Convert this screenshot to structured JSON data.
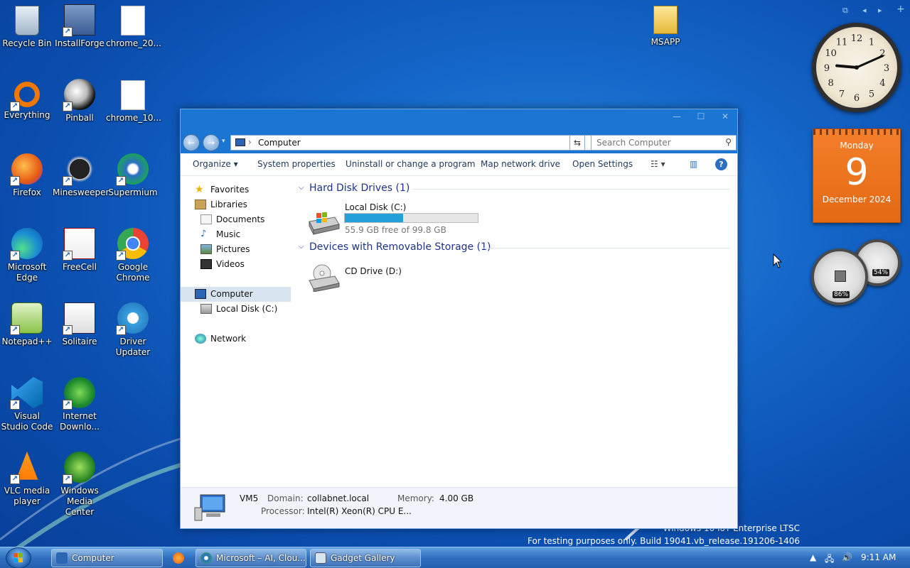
{
  "desktop": {
    "icons": [
      {
        "label": "Recycle Bin",
        "icon": "recycle-bin-icon"
      },
      {
        "label": "InstallForge",
        "icon": "installforge-icon"
      },
      {
        "label": "chrome_20...",
        "icon": "file-icon"
      },
      {
        "label": "Everything",
        "icon": "everything-icon"
      },
      {
        "label": "Pinball",
        "icon": "pinball-icon"
      },
      {
        "label": "chrome_10...",
        "icon": "file-icon"
      },
      {
        "label": "Firefox",
        "icon": "firefox-icon"
      },
      {
        "label": "Minesweeper",
        "icon": "minesweeper-icon"
      },
      {
        "label": "Supermium",
        "icon": "supermium-icon"
      },
      {
        "label": "Microsoft Edge",
        "icon": "edge-icon"
      },
      {
        "label": "FreeCell",
        "icon": "freecell-icon"
      },
      {
        "label": "Google Chrome",
        "icon": "chrome-icon"
      },
      {
        "label": "Notepad++",
        "icon": "notepadpp-icon"
      },
      {
        "label": "Solitaire",
        "icon": "solitaire-icon"
      },
      {
        "label": "Driver Updater",
        "icon": "driver-updater-icon"
      },
      {
        "label": "Visual Studio Code",
        "icon": "vscode-icon"
      },
      {
        "label": "Internet Downlo...",
        "icon": "idm-icon"
      },
      {
        "label": "VLC media player",
        "icon": "vlc-icon"
      },
      {
        "label": "Windows Media Center",
        "icon": "wmc-icon"
      },
      {
        "label": "MSAPP",
        "icon": "folder-icon"
      }
    ],
    "watermark_line1": "Windows 10 IoT Enterprise LTSC",
    "watermark_line2": "For testing purposes only. Build 19041.vb_release.191206-1406"
  },
  "explorer": {
    "address": "Computer",
    "search_placeholder": "Search Computer",
    "toolbar": {
      "organize": "Organize",
      "system_properties": "System properties",
      "uninstall": "Uninstall or change a program",
      "map_drive": "Map network drive",
      "open_settings": "Open Settings"
    },
    "nav": {
      "favorites": "Favorites",
      "libraries": "Libraries",
      "documents": "Documents",
      "music": "Music",
      "pictures": "Pictures",
      "videos": "Videos",
      "computer": "Computer",
      "local_disk": "Local Disk (C:)",
      "network": "Network"
    },
    "groups": {
      "hdd": "Hard Disk Drives (1)",
      "removable": "Devices with Removable Storage (1)"
    },
    "drives": {
      "c_name": "Local Disk (C:)",
      "c_free": "55.9 GB free of 99.8 GB",
      "c_used_fraction": 0.44,
      "d_name": "CD Drive (D:)"
    },
    "details": {
      "name": "VM5",
      "domain_label": "Domain:",
      "domain": "collabnet.local",
      "memory_label": "Memory:",
      "memory": "4.00 GB",
      "processor_label": "Processor:",
      "processor": "Intel(R) Xeon(R) CPU E..."
    }
  },
  "gadgets": {
    "calendar_day": "Monday",
    "calendar_date": "9",
    "calendar_month_year": "December 2024",
    "cpu": "86%",
    "mem": "54%",
    "clock_numbers": [
      "12",
      "1",
      "2",
      "3",
      "4",
      "5",
      "6",
      "7",
      "8",
      "9",
      "10",
      "11"
    ]
  },
  "taskbar": {
    "items": [
      "Computer",
      "Microsoft – AI, Clou...",
      "Gadget Gallery"
    ],
    "time": "9:11 AM"
  }
}
